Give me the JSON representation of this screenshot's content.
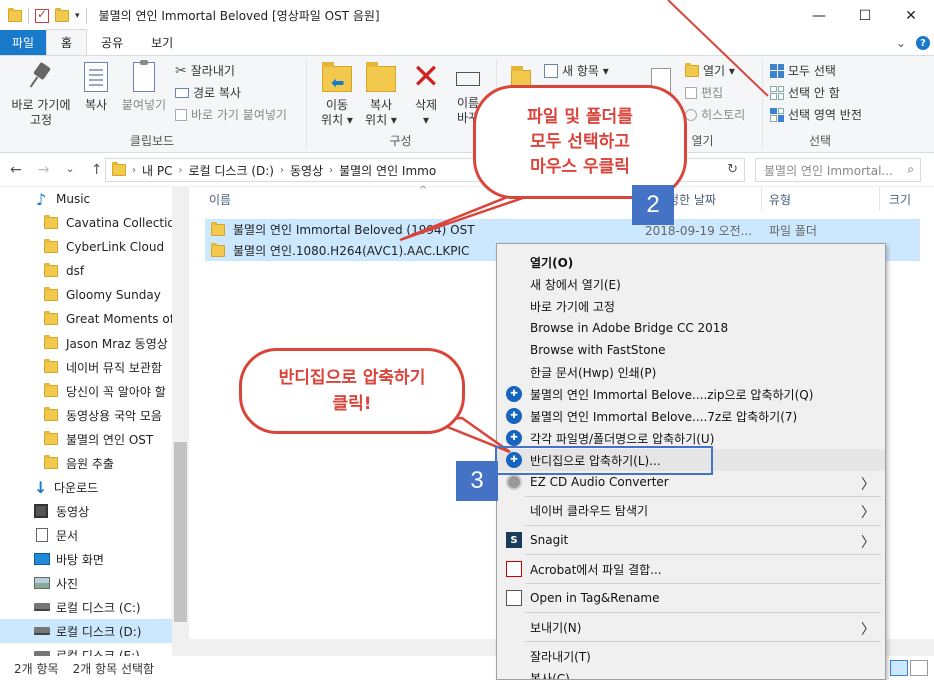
{
  "titlebar": {
    "title": "불멸의 연인 Immortal Beloved [영상파일 OST 음원]",
    "minimize": "—",
    "maximize": "☐",
    "close": "✕",
    "qat_drop": "▾"
  },
  "tabs": {
    "file": "파일",
    "items": [
      "홈",
      "공유",
      "보기"
    ],
    "active": "홈",
    "collapse": "⌄",
    "help": "?"
  },
  "ribbon": {
    "clipboard": {
      "label": "클립보드",
      "pin": [
        "바로 가기에",
        "고정"
      ],
      "copy": "복사",
      "paste": "붙여넣기",
      "cut": "잘라내기",
      "copy_path": "경로 복사",
      "paste_shortcut": "바로 가기 붙여넣기"
    },
    "organize": {
      "label": "구성",
      "move": [
        "이동",
        "위치 ▾"
      ],
      "copyto": [
        "복사",
        "위치 ▾"
      ],
      "delete": [
        "삭제",
        "▾"
      ],
      "rename": [
        "이름",
        "바꾸"
      ]
    },
    "new_item": "새 항목 ▾",
    "open": {
      "label": "열기",
      "open_btn": "열기 ▾",
      "edit": "편집",
      "history": "히스토리"
    },
    "select": {
      "label": "선택",
      "select_all": "모두 선택",
      "select_none": "선택 안 함",
      "invert": "선택 영역 반전"
    }
  },
  "address": {
    "back": "←",
    "forward": "→",
    "dropdown": "⌄",
    "up": "↑",
    "crumbs": [
      "내 PC",
      "로컬 디스크 (D:)",
      "동영상",
      "불멸의 연인 Immo"
    ],
    "refresh": "↻",
    "search_placeholder": "불멸의 연인 Immortal...",
    "search_icon": "⌕"
  },
  "nav": {
    "items": [
      {
        "label": "Music",
        "icon": "music"
      },
      {
        "label": "Cavatina Collection",
        "icon": "folder"
      },
      {
        "label": "CyberLink Cloud",
        "icon": "folder"
      },
      {
        "label": "dsf",
        "icon": "folder"
      },
      {
        "label": "Gloomy Sunday",
        "icon": "folder"
      },
      {
        "label": "Great Moments of A",
        "icon": "folder"
      },
      {
        "label": "Jason Mraz 동영상 ㄱ",
        "icon": "folder"
      },
      {
        "label": "네이버 뮤직 보관함",
        "icon": "folder"
      },
      {
        "label": "당신이 꼭 알아야 할",
        "icon": "folder"
      },
      {
        "label": "동영상용 국악 모음",
        "icon": "folder"
      },
      {
        "label": "불멸의 연인 OST",
        "icon": "folder"
      },
      {
        "label": "음원 추출",
        "icon": "folder"
      },
      {
        "label": "다운로드",
        "icon": "download"
      },
      {
        "label": "동영상",
        "icon": "video"
      },
      {
        "label": "문서",
        "icon": "docs"
      },
      {
        "label": "바탕 화면",
        "icon": "desktop"
      },
      {
        "label": "사진",
        "icon": "pictures"
      },
      {
        "label": "로컬 디스크 (C:)",
        "icon": "drive"
      },
      {
        "label": "로컬 디스크 (D:)",
        "icon": "drive"
      },
      {
        "label": "로컬 디스크 (E:)",
        "icon": "drive"
      }
    ],
    "selected": "로컬 디스크 (D:)"
  },
  "content": {
    "columns": [
      "이름",
      "수정한 날짜",
      "유형",
      "크기"
    ],
    "sort_indicator": "^",
    "rows": [
      {
        "name": "불멸의 연인 Immortal Beloved (1994) OST",
        "date": "2018-09-19 오전...",
        "type": "파일 폴더"
      },
      {
        "name": "불멸의 연인.1080.H264(AVC1).AAC.LKPIC",
        "date": "",
        "type": "파일 폴더"
      }
    ]
  },
  "status": {
    "count": "2개 항목",
    "selected": "2개 항목 선택함"
  },
  "context_menu": {
    "items": [
      {
        "label": "열기(O)",
        "bold": true
      },
      {
        "label": "새 창에서 열기(E)"
      },
      {
        "label": "바로 가기에 고정"
      },
      {
        "label": "Browse in Adobe Bridge CC 2018"
      },
      {
        "label": "Browse with FastStone"
      },
      {
        "label": "한글 문서(Hwp) 인쇄(P)"
      },
      {
        "label": "불멸의 연인 Immortal Belove....zip으로 압축하기(Q)",
        "icon": "bandizip"
      },
      {
        "label": "불멸의 연인 Immortal Belove....7z로 압축하기(7)",
        "icon": "bandizip"
      },
      {
        "label": "각각 파일명/폴더명으로 압축하기(U)",
        "icon": "bandizip"
      },
      {
        "label": "반디집으로 압축하기(L)...",
        "icon": "bandizip",
        "hover": true
      },
      {
        "label": "EZ CD Audio Converter",
        "icon": "ez",
        "submenu": true
      },
      {
        "label": "네이버 클라우드 탐색기",
        "submenu": true
      },
      {
        "label": "Snagit",
        "icon": "snagit",
        "submenu": true
      },
      {
        "label": "Acrobat에서 파일 결합...",
        "icon": "acrobat"
      },
      {
        "label": "Open in Tag&Rename",
        "icon": "tagrename"
      },
      {
        "label": "보내기(N)",
        "submenu": true
      },
      {
        "label": "잘라내기(T)"
      },
      {
        "label": "복사(C)"
      }
    ],
    "submenu_arrow": "〉",
    "snagit_icon_text": "S",
    "acrobat_icon_text": "A"
  },
  "annotations": {
    "bubble1": [
      "파일 및 폴더를",
      "모두 선택하고",
      "마우스 우클릭"
    ],
    "bubble2": [
      "반디집으로 압축하기",
      "클릭!"
    ],
    "step2": "2",
    "step3": "3",
    "color": "#d9453b",
    "step_color": "#4472c4"
  }
}
